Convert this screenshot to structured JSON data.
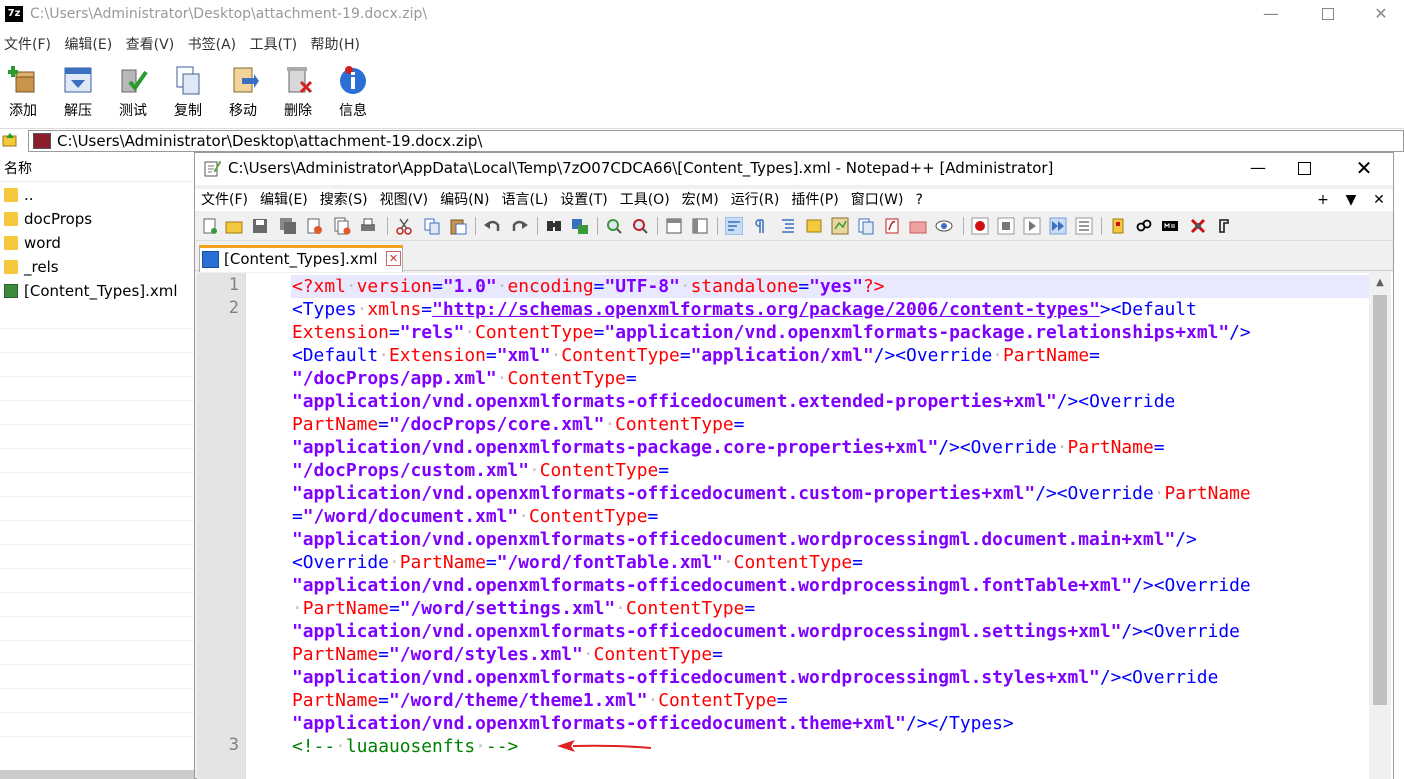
{
  "sevenzip": {
    "logo": "7z",
    "title": "C:\\Users\\Administrator\\Desktop\\attachment-19.docx.zip\\",
    "menu": [
      "文件(F)",
      "编辑(E)",
      "查看(V)",
      "书签(A)",
      "工具(T)",
      "帮助(H)"
    ],
    "toolbar": [
      {
        "label": "添加",
        "icon": "add-icon"
      },
      {
        "label": "解压",
        "icon": "extract-icon"
      },
      {
        "label": "测试",
        "icon": "test-icon"
      },
      {
        "label": "复制",
        "icon": "copy-icon"
      },
      {
        "label": "移动",
        "icon": "move-icon"
      },
      {
        "label": "删除",
        "icon": "delete-icon"
      },
      {
        "label": "信息",
        "icon": "info-icon"
      }
    ],
    "address": "C:\\Users\\Administrator\\Desktop\\attachment-19.docx.zip\\",
    "column_name": "名称",
    "files": [
      {
        "name": "..",
        "icon": "folder-icon"
      },
      {
        "name": "docProps",
        "icon": "folder-icon"
      },
      {
        "name": "word",
        "icon": "folder-icon"
      },
      {
        "name": "_rels",
        "icon": "folder-icon"
      },
      {
        "name": "[Content_Types].xml",
        "icon": "xml-file-icon"
      }
    ]
  },
  "notepad": {
    "title": "C:\\Users\\Administrator\\AppData\\Local\\Temp\\7zO07CDCA66\\[Content_Types].xml - Notepad++ [Administrator]",
    "window_controls": {
      "minimize": "—",
      "close": "✕"
    },
    "menu": [
      "文件(F)",
      "编辑(E)",
      "搜索(S)",
      "视图(V)",
      "编码(N)",
      "语言(L)",
      "设置(T)",
      "工具(O)",
      "宏(M)",
      "运行(R)",
      "插件(P)",
      "窗口(W)",
      "?"
    ],
    "menu_right": [
      "+",
      "▼",
      "✕"
    ],
    "tab_label": "[Content_Types].xml",
    "tab_close": "✕",
    "line_numbers": [
      "1",
      "2",
      "3"
    ],
    "scroll_up": "▲",
    "code_lines": [
      "<?xml version=\"1.0\" encoding=\"UTF-8\" standalone=\"yes\"?>",
      "<Types xmlns=\"http://schemas.openxmlformats.org/package/2006/content-types\"><Default",
      "Extension=\"rels\" ContentType=\"application/vnd.openxmlformats-package.relationships+xml\"/>",
      "<Default Extension=\"xml\" ContentType=\"application/xml\"/><Override PartName=",
      "\"/docProps/app.xml\" ContentType=",
      "\"application/vnd.openxmlformats-officedocument.extended-properties+xml\"/><Override",
      "PartName=\"/docProps/core.xml\" ContentType=",
      "\"application/vnd.openxmlformats-package.core-properties+xml\"/><Override PartName=",
      "\"/docProps/custom.xml\" ContentType=",
      "\"application/vnd.openxmlformats-officedocument.custom-properties+xml\"/><Override PartName",
      "=\"/word/document.xml\" ContentType=",
      "\"application/vnd.openxmlformats-officedocument.wordprocessingml.document.main+xml\"/>",
      "<Override PartName=\"/word/fontTable.xml\" ContentType=",
      "\"application/vnd.openxmlformats-officedocument.wordprocessingml.fontTable+xml\"/><Override",
      " PartName=\"/word/settings.xml\" ContentType=",
      "\"application/vnd.openxmlformats-officedocument.wordprocessingml.settings+xml\"/><Override",
      "PartName=\"/word/styles.xml\" ContentType=",
      "\"application/vnd.openxmlformats-officedocument.wordprocessingml.styles+xml\"/><Override",
      "PartName=\"/word/theme/theme1.xml\" ContentType=",
      "\"application/vnd.openxmlformats-officedocument.theme+xml\"/></Types>",
      "<!-- luaauosenfts -->"
    ]
  },
  "annotation": {
    "arrow_color": "#e02020"
  }
}
